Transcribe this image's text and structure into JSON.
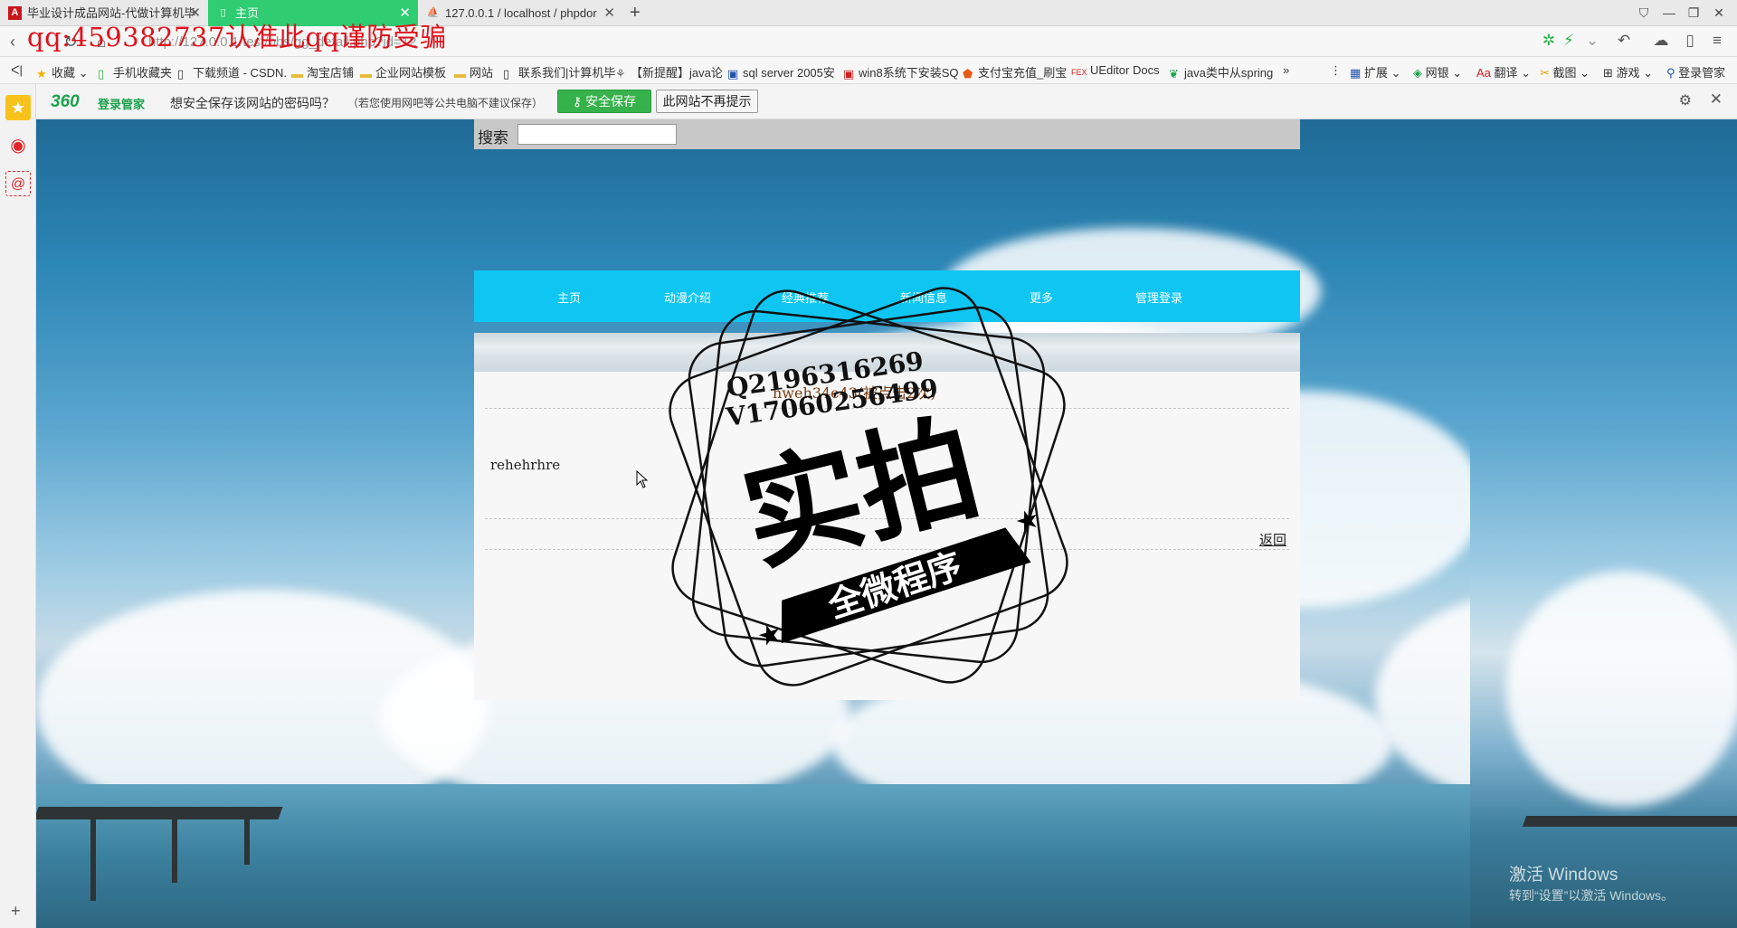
{
  "tabs": [
    {
      "label": "毕业设计成品网站-代做计算机毕",
      "icon": "pdf-icon"
    },
    {
      "label": "主页",
      "icon": "page-icon"
    },
    {
      "label": "127.0.0.1 / localhost / phpdor",
      "icon": "phpmyadmin-icon"
    }
  ],
  "address": {
    "url": "http://127.0.0.1/test/bbs/gg_detail.php?id=12",
    "overlay_text": "qq:459382737认准此qq谨防受骗"
  },
  "bookmarks": [
    {
      "label": "收藏",
      "icon": "star-icon"
    },
    {
      "label": "手机收藏夹",
      "icon": "phone-icon"
    },
    {
      "label": "下载频道 - CSDN.",
      "icon": "page-icon"
    },
    {
      "label": "淘宝店铺",
      "icon": "folder-icon"
    },
    {
      "label": "企业网站模板",
      "icon": "folder-icon"
    },
    {
      "label": "网站",
      "icon": "folder-icon"
    },
    {
      "label": "联系我们|计算机毕",
      "icon": "page-icon"
    },
    {
      "label": "【新提醒】java论",
      "icon": "java-icon"
    },
    {
      "label": "sql server 2005安",
      "icon": "image-icon"
    },
    {
      "label": "win8系统下安装SQ",
      "icon": "win-icon"
    },
    {
      "label": "支付宝充值_刷宝",
      "icon": "shield-icon"
    },
    {
      "label": "UEditor Docs",
      "icon": "fex-icon"
    },
    {
      "label": "java类中从spring",
      "icon": "leaf-icon"
    }
  ],
  "toolbar_right": {
    "ext": "扩展",
    "netbank": "网银",
    "translate": "翻译",
    "screenshot": "截图",
    "games": "游戏",
    "login": "登录管家"
  },
  "password_bar": {
    "logo": "360",
    "logo_text": "登录管家",
    "question": "想安全保存该网站的密码吗？",
    "note": "（若您使用网吧等公共电脑不建议保存）",
    "save_label": "安全保存",
    "no_more_label": "此网站不再提示"
  },
  "site": {
    "search_label": "搜索",
    "search_value": "",
    "nav": [
      "主页",
      "动漫介绍",
      "经典推荐",
      "新闻信息",
      "更多",
      "管理登录"
    ],
    "title_link": "hweh34e43(被点击2次)",
    "body_text": "rehehrhre",
    "back_label": "返回"
  },
  "watermark": {
    "line1": "Q2196316269",
    "line2": "V17060256499",
    "big": "实拍",
    "banner": "全微程序"
  },
  "windows_activation": {
    "title": "激活 Windows",
    "sub": "转到“设置”以激活 Windows。"
  },
  "colors": {
    "active_tab": "#2fcc71",
    "nav_bg": "#0fc6f3",
    "save_btn": "#36b24a",
    "overlay_red": "#e0111b"
  }
}
